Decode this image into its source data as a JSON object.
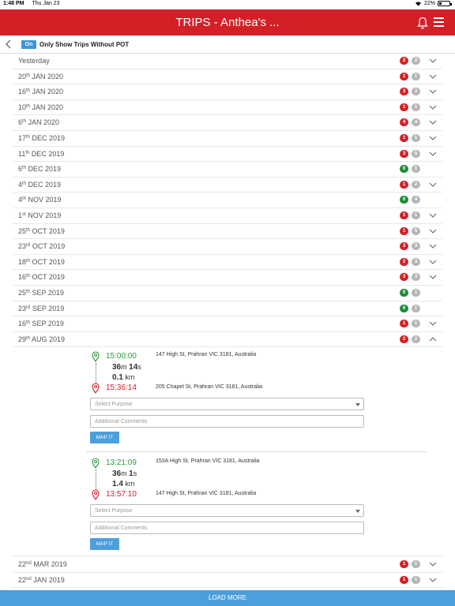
{
  "status_bar": {
    "time": "1:48 PM",
    "date": "Thu Jan 23",
    "battery": "22%"
  },
  "header": {
    "title": "TRIPS - Anthea's ..."
  },
  "filter": {
    "toggle_label": "On",
    "label": "Only Show Trips Without POT"
  },
  "rows_top": [
    {
      "day": "Yesterday",
      "suffix": "",
      "rest": "",
      "red": "2",
      "grey": "2",
      "green": false,
      "chevron": true
    },
    {
      "day": "20",
      "suffix": "th",
      "rest": " JAN 2020",
      "red": "1",
      "grey": "1",
      "green": false,
      "chevron": true
    },
    {
      "day": "16",
      "suffix": "th",
      "rest": " JAN 2020",
      "red": "3",
      "grey": "3",
      "green": false,
      "chevron": true
    },
    {
      "day": "10",
      "suffix": "th",
      "rest": " JAN 2020",
      "red": "1",
      "grey": "1",
      "green": false,
      "chevron": true
    },
    {
      "day": "6",
      "suffix": "th",
      "rest": " JAN 2020",
      "red": "4",
      "grey": "4",
      "green": false,
      "chevron": true
    },
    {
      "day": "17",
      "suffix": "th",
      "rest": " DEC 2019",
      "red": "1",
      "grey": "1",
      "green": false,
      "chevron": true
    },
    {
      "day": "11",
      "suffix": "th",
      "rest": " DEC 2019",
      "red": "3",
      "grey": "5",
      "green": false,
      "chevron": true
    },
    {
      "day": "6",
      "suffix": "th",
      "rest": " DEC 2019",
      "red": "0",
      "grey": "1",
      "green": true,
      "chevron": false
    },
    {
      "day": "4",
      "suffix": "th",
      "rest": " DEC 2019",
      "red": "1",
      "grey": "2",
      "green": false,
      "chevron": true
    },
    {
      "day": "4",
      "suffix": "th",
      "rest": " NOV 2019",
      "red": "0",
      "grey": "4",
      "green": true,
      "chevron": false
    },
    {
      "day": "1",
      "suffix": "st",
      "rest": " NOV 2019",
      "red": "1",
      "grey": "1",
      "green": false,
      "chevron": true
    },
    {
      "day": "25",
      "suffix": "th",
      "rest": " OCT 2019",
      "red": "1",
      "grey": "5",
      "green": false,
      "chevron": true
    },
    {
      "day": "23",
      "suffix": "rd",
      "rest": " OCT 2019",
      "red": "3",
      "grey": "3",
      "green": false,
      "chevron": true
    },
    {
      "day": "18",
      "suffix": "th",
      "rest": " OCT 2019",
      "red": "2",
      "grey": "3",
      "green": false,
      "chevron": true
    },
    {
      "day": "16",
      "suffix": "th",
      "rest": " OCT 2019",
      "red": "3",
      "grey": "3",
      "green": false,
      "chevron": true
    },
    {
      "day": "25",
      "suffix": "th",
      "rest": " SEP 2019",
      "red": "0",
      "grey": "1",
      "green": true,
      "chevron": false
    },
    {
      "day": "23",
      "suffix": "rd",
      "rest": " SEP 2019",
      "red": "0",
      "grey": "1",
      "green": true,
      "chevron": false
    },
    {
      "day": "16",
      "suffix": "th",
      "rest": " SEP 2019",
      "red": "1",
      "grey": "1",
      "green": false,
      "chevron": true
    },
    {
      "day": "29",
      "suffix": "th",
      "rest": " AUG 2019",
      "red": "2",
      "grey": "2",
      "green": false,
      "chevron": true,
      "expanded": true
    }
  ],
  "trips": [
    {
      "start_time": "15:00:00",
      "start_address": "147 High St, Prahran VIC 3181, Australia",
      "duration_min": "36",
      "duration_min_unit": "m",
      "duration_sec": "14",
      "duration_sec_unit": "s",
      "distance": "0.1",
      "distance_unit": " km",
      "end_time": "15:36:14",
      "end_address": "205 Chapel St, Prahran VIC 3181, Australia",
      "purpose_placeholder": "Select Purpose",
      "comments_placeholder": "Additional Comments",
      "map_button": "MAP IT"
    },
    {
      "start_time": "13:21:09",
      "start_address": "153A High St, Prahran VIC 3181, Australia",
      "duration_min": "36",
      "duration_min_unit": "m",
      "duration_sec": "1",
      "duration_sec_unit": "s",
      "distance": "1.4",
      "distance_unit": " km",
      "end_time": "13:57:10",
      "end_address": "147 High St, Prahran VIC 3181, Australia",
      "purpose_placeholder": "Select Purpose",
      "comments_placeholder": "Additional Comments",
      "map_button": "MAP IT"
    }
  ],
  "rows_bottom": [
    {
      "day": "22",
      "suffix": "nd",
      "rest": " MAR 2019",
      "red": "1",
      "grey": "1",
      "green": false,
      "chevron": true
    },
    {
      "day": "22",
      "suffix": "nd",
      "rest": " JAN 2019",
      "red": "1",
      "grey": "1",
      "green": false,
      "chevron": true
    }
  ],
  "load_more": "LOAD MORE",
  "colors": {
    "brand_red": "#d32027",
    "accent_blue": "#4b9fdb",
    "green": "#1e8c36",
    "badge_grey": "#b5b5b5"
  }
}
